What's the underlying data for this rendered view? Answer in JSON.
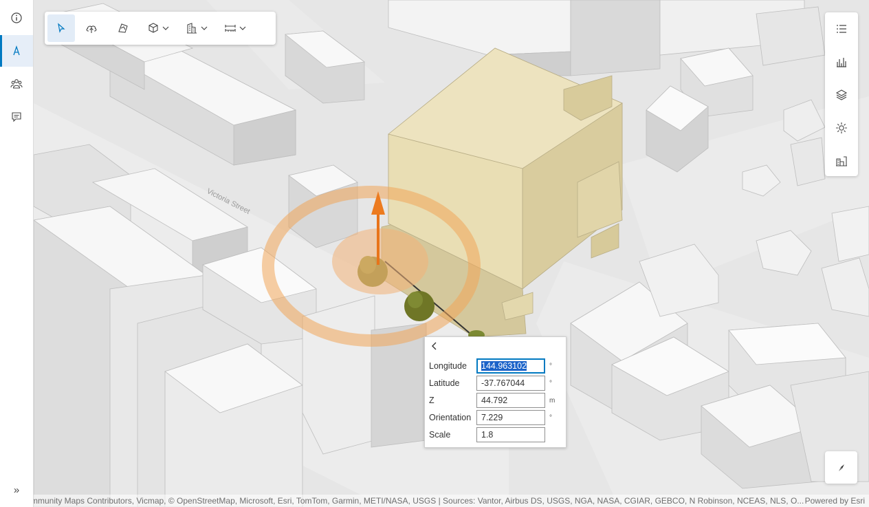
{
  "left_rail": {
    "items": [
      {
        "icon": "info-icon"
      },
      {
        "icon": "pen-edit-icon",
        "active": true
      },
      {
        "icon": "people-icon"
      },
      {
        "icon": "comment-icon"
      }
    ],
    "collapse_label": "»"
  },
  "toolbar": {
    "tools": [
      {
        "icon": "select-pointer-icon",
        "active": true
      },
      {
        "icon": "upload-cloud-icon"
      },
      {
        "icon": "transform-icon"
      },
      {
        "icon": "cube-icon",
        "dropdown": true
      },
      {
        "icon": "building-icon",
        "dropdown": true
      },
      {
        "icon": "measure-icon",
        "dropdown": true
      }
    ]
  },
  "right_panel": {
    "buttons": [
      "list-icon",
      "chart-icon",
      "layers-icon",
      "sun-icon",
      "building-stats-icon"
    ]
  },
  "popup": {
    "fields": [
      {
        "label": "Longitude",
        "value": "144.963102",
        "unit": "°",
        "focused": true
      },
      {
        "label": "Latitude",
        "value": "-37.767044",
        "unit": "°"
      },
      {
        "label": "Z",
        "value": "44.792",
        "unit": "m"
      },
      {
        "label": "Orientation",
        "value": "7.229",
        "unit": "°"
      },
      {
        "label": "Scale",
        "value": "1.8",
        "unit": ""
      }
    ]
  },
  "map": {
    "street_label": "Victoria Street"
  },
  "attribution": {
    "text": "mmunity Maps Contributors, Vicmap, © OpenStreetMap, Microsoft, Esri, TomTom, Garmin, METI/NASA, USGS | Sources: Vantor, Airbus DS, USGS, NGA, NASA, CGIAR, GEBCO, N Robinson, NCEAS, NLS, O...",
    "powered": "Powered by Esri"
  },
  "colors": {
    "accent": "#0079c1",
    "building_highlight": "#e8dcae",
    "manipulator": "#f08a24"
  }
}
